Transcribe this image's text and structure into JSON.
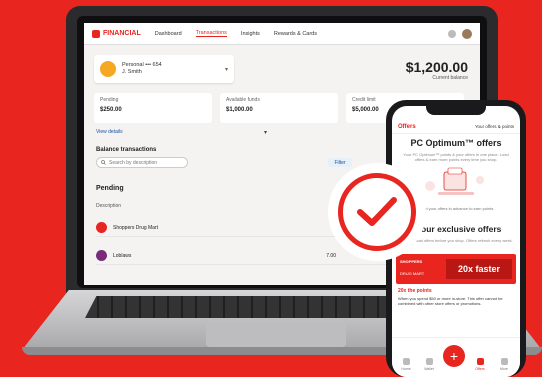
{
  "laptop": {
    "nav": {
      "brand": "FINANCIAL",
      "links": [
        "Dashboard",
        "Transactions",
        "Insights",
        "Rewards & Cards"
      ]
    },
    "account": {
      "name": "Personal ••• 654",
      "holder": "J. Smith"
    },
    "balance": {
      "amount": "$1,200.00",
      "label": "Current balance"
    },
    "stats": [
      {
        "label": "Pending",
        "value": "$250.00"
      },
      {
        "label": "Available funds",
        "value": "$1,000.00"
      },
      {
        "label": "Credit limit",
        "value": "$5,000.00"
      }
    ],
    "view_details": "View details",
    "section_title": "Balance transactions",
    "search_placeholder": "Search by description",
    "filter_label": "Filter",
    "pending_title": "Pending",
    "description_header": "Description",
    "rows": [
      {
        "name": "Shoppers Drug Mart",
        "amount": "",
        "color": "#e8251f"
      },
      {
        "name": "Loblaws",
        "amount": "7.00",
        "color": "#7a2a7a"
      }
    ]
  },
  "phone": {
    "header_title": "Offers",
    "header_link": "Your offers & points",
    "h1": "PC Optimum™ offers",
    "intro": "Your PC Optimum™ points & your offers in one place. Load offers & earn more points every time you shop.",
    "illus_caption": "Load your offers in advance to earn points",
    "h2": "Your exclusive offers",
    "sub": "Load offers before you shop. Offers refresh every week.",
    "promo": {
      "brand": "SHOPPERS",
      "sub": "DRUG MART",
      "chip": "20x faster"
    },
    "offer_title": "20x the points",
    "offer_body": "When you spend $50 or more in-store. This offer cannot be combined with other store offers or promotions.",
    "tabs": [
      "Home",
      "Wallet",
      "Offers",
      "More"
    ],
    "fab_symbol": "+"
  },
  "colors": {
    "brand": "#e8251f",
    "link": "#1a4fa0"
  }
}
